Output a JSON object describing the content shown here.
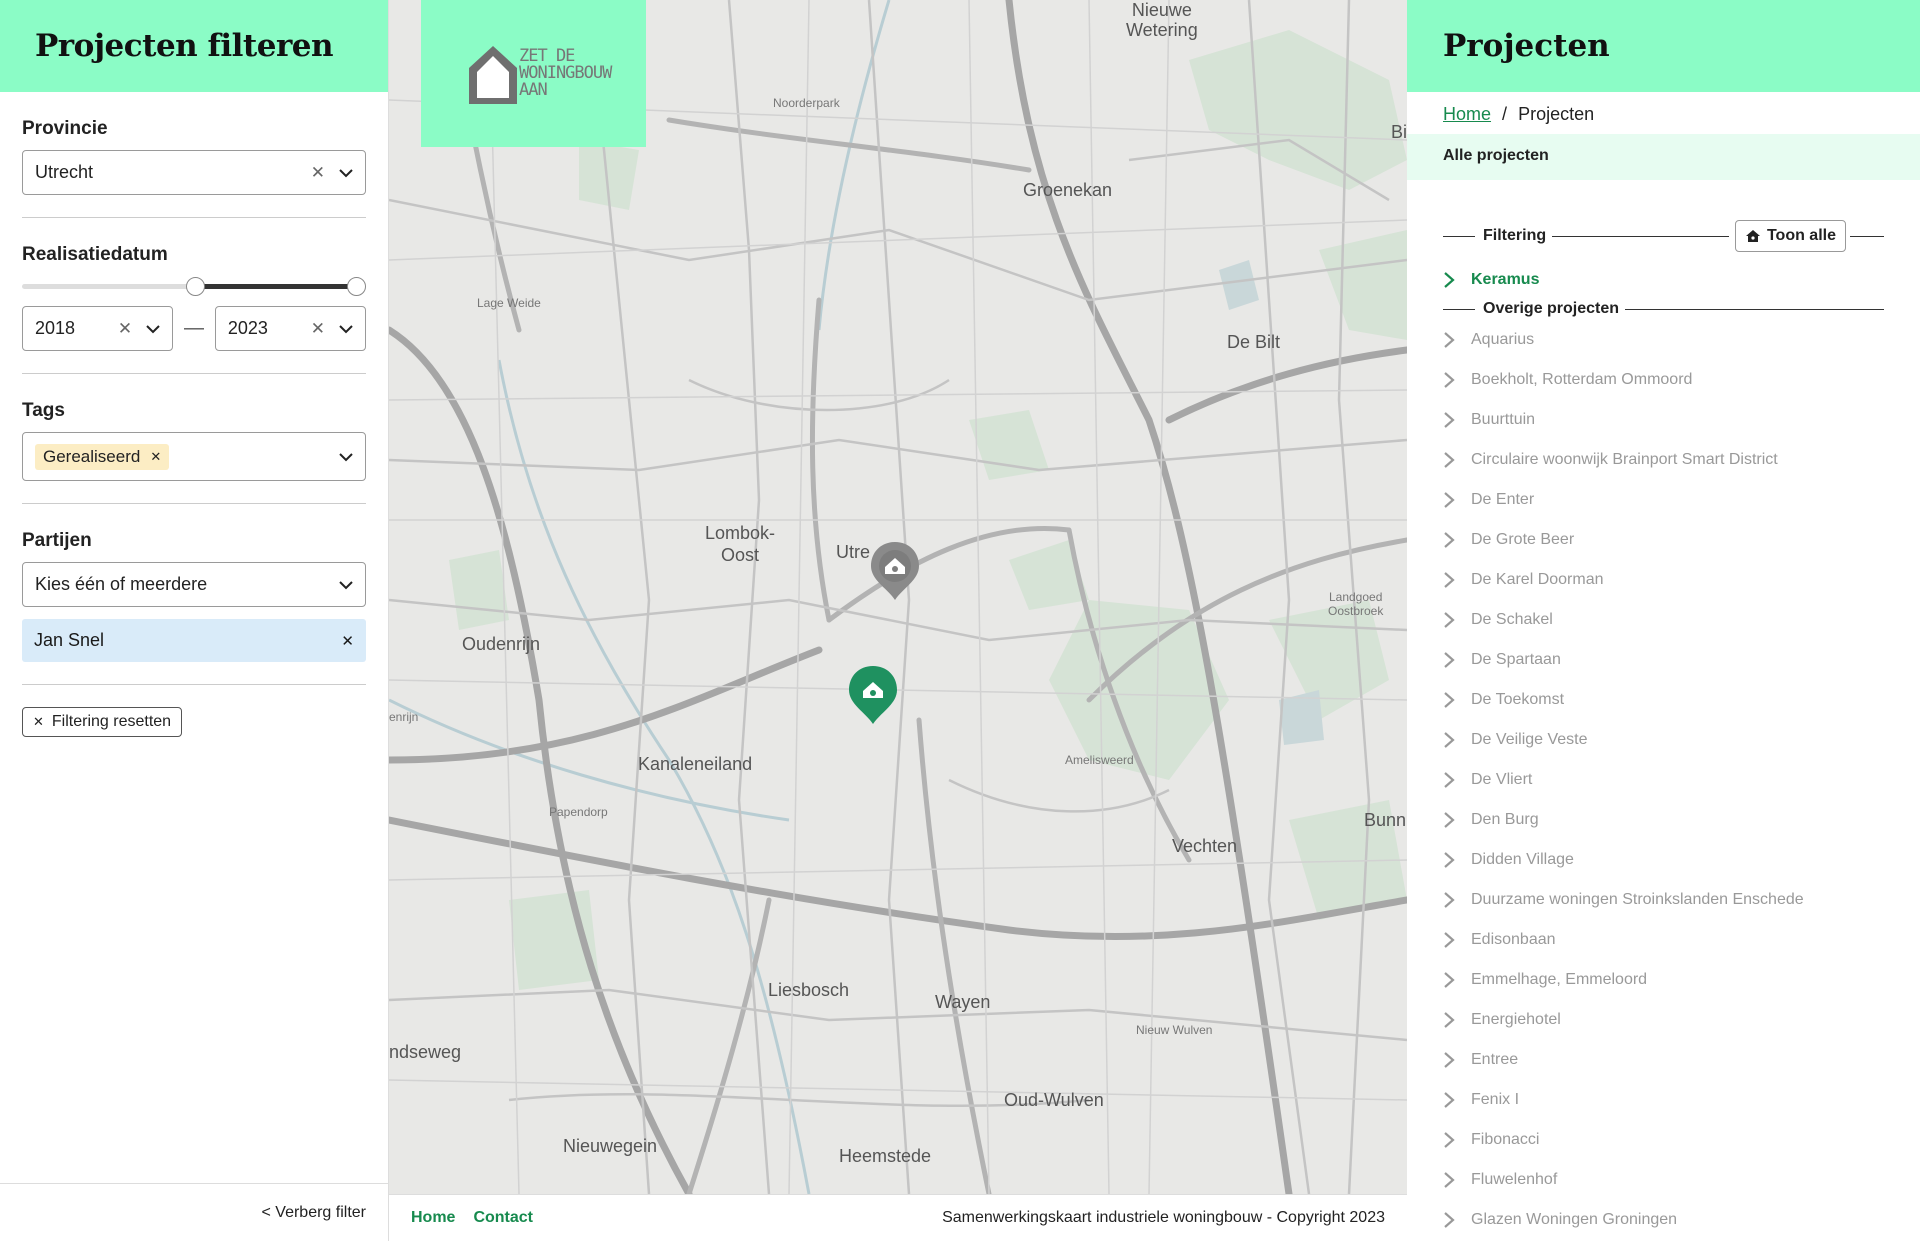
{
  "filter_panel": {
    "title": "Projecten filteren",
    "provincie": {
      "label": "Provincie",
      "value": "Utrecht"
    },
    "realisatiedatum": {
      "label": "Realisatiedatum",
      "from": "2018",
      "to": "2023",
      "range_fraction": [
        0.505,
        1.0
      ]
    },
    "tags": {
      "label": "Tags",
      "selected": "Gerealiseerd"
    },
    "partijen": {
      "label": "Partijen",
      "placeholder": "Kies één of meerdere",
      "selected": "Jan Snel"
    },
    "reset_label": "Filtering resetten",
    "hide_label": "< Verberg filter"
  },
  "map": {
    "labels": {
      "nieuwe_wetering": "Nieuwe\nWetering",
      "noorderpark": "Noorderpark",
      "groenekan": "Groenekan",
      "de_bilt": "De Bilt",
      "lage_weide": "Lage Weide",
      "lombok_oost": "Lombok-\nOost",
      "utrecht": "Utre",
      "oudenrijn": "Oudenrijn",
      "kanaleneiland": "Kanaleneiland",
      "papendorp": "Papendorp",
      "landgoed": "Landgoed\nOostbroek",
      "amelisweerd": "Amelisweerd",
      "bunnik": "Bunnik",
      "vechten": "Vechten",
      "liesbosch": "Liesbosch",
      "wayen": "Wayen",
      "nieuw_wulven": "Nieuw Wulven",
      "oud_wulven": "Oud-Wulven",
      "heemstede": "Heemstede",
      "nieuwegein": "Nieuwegein",
      "ndseweg": "ndseweg",
      "bi": "Bi",
      "enrijn": "enrijn"
    },
    "logo_text": "ZET DE\nWONINGBOUW\nAAN"
  },
  "footer": {
    "home": "Home",
    "contact": "Contact",
    "copyright": "Samenwerkingskaart industriele woningbouw - Copyright 2023"
  },
  "projects_panel": {
    "title": "Projecten",
    "breadcrumb_home": "Home",
    "breadcrumb_sep": "/",
    "breadcrumb_current": "Projecten",
    "all_label": "Alle projecten",
    "filtering_label": "Filtering",
    "show_all_label": "Toon alle",
    "filtered": [
      "Keramus"
    ],
    "other_label": "Overige projecten",
    "other": [
      "Aquarius",
      "Boekholt, Rotterdam Ommoord",
      "Buurttuin",
      "Circulaire woonwijk Brainport Smart District",
      "De Enter",
      "De Grote Beer",
      "De Karel Doorman",
      "De Schakel",
      "De Spartaan",
      "De Toekomst",
      "De Veilige Veste",
      "De Vliert",
      "Den Burg",
      "Didden Village",
      "Duurzame woningen Stroinkslanden Enschede",
      "Edisonbaan",
      "Emmelhage, Emmeloord",
      "Energiehotel",
      "Entree",
      "Fenix I",
      "Fibonacci",
      "Fluwelenhof",
      "Glazen Woningen Groningen"
    ]
  },
  "colors": {
    "accent": "#8bfcc6",
    "green": "#178a4e",
    "pin_gray": "#8a8a8a"
  }
}
